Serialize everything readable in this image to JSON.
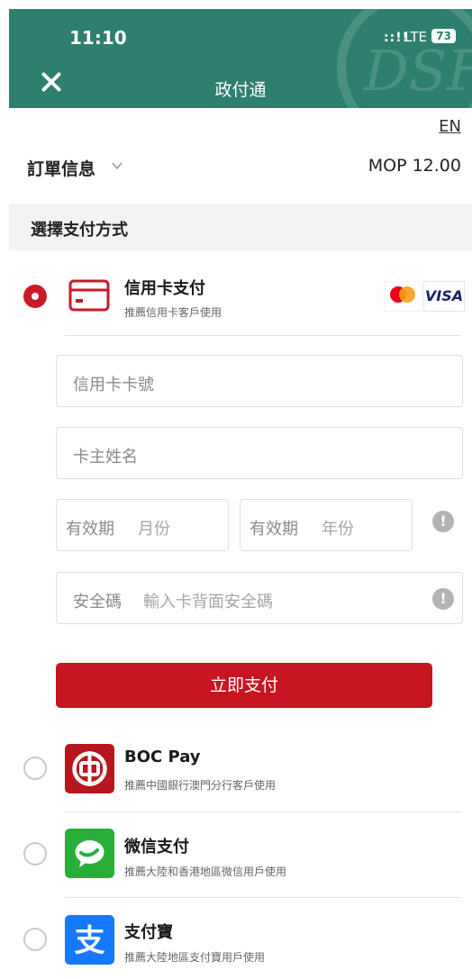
{
  "status_bar": {
    "time": "11:10",
    "network": "LTE",
    "battery": "73"
  },
  "header": {
    "title": "政付通",
    "watermark": "DSF"
  },
  "lang_toggle": "EN",
  "order": {
    "label": "訂單信息",
    "amount": "MOP 12.00"
  },
  "section": {
    "title": "選擇支付方式"
  },
  "credit_card": {
    "title": "信用卡支付",
    "subtitle": "推薦信用卡客戶使用",
    "visa_label": "VISA",
    "card_number_placeholder": "信用卡卡號",
    "cardholder_placeholder": "卡主姓名",
    "expiry_label": "有效期",
    "expiry_month_placeholder": "月份",
    "expiry_year_placeholder": "年份",
    "cvv_label": "安全碼",
    "cvv_placeholder": "輸入卡背面安全碼",
    "info_symbol": "!"
  },
  "pay_button": "立即支付",
  "methods": [
    {
      "title": "BOC Pay",
      "subtitle": "推薦中國銀行澳門分行客戶使用",
      "icon": "boc-icon"
    },
    {
      "title": "微信支付",
      "subtitle": "推薦大陸和香港地區微信用戶使用",
      "icon": "wechat-icon"
    },
    {
      "title": "支付寶",
      "subtitle": "推薦大陸地區支付寶用戶使用",
      "icon": "alipay-icon",
      "icon_glyph": "支"
    }
  ],
  "colors": {
    "header": "#2e7f6f",
    "accent": "#c71522",
    "boc": "#b8161f",
    "wechat": "#2aae3a",
    "alipay": "#1677ff"
  }
}
